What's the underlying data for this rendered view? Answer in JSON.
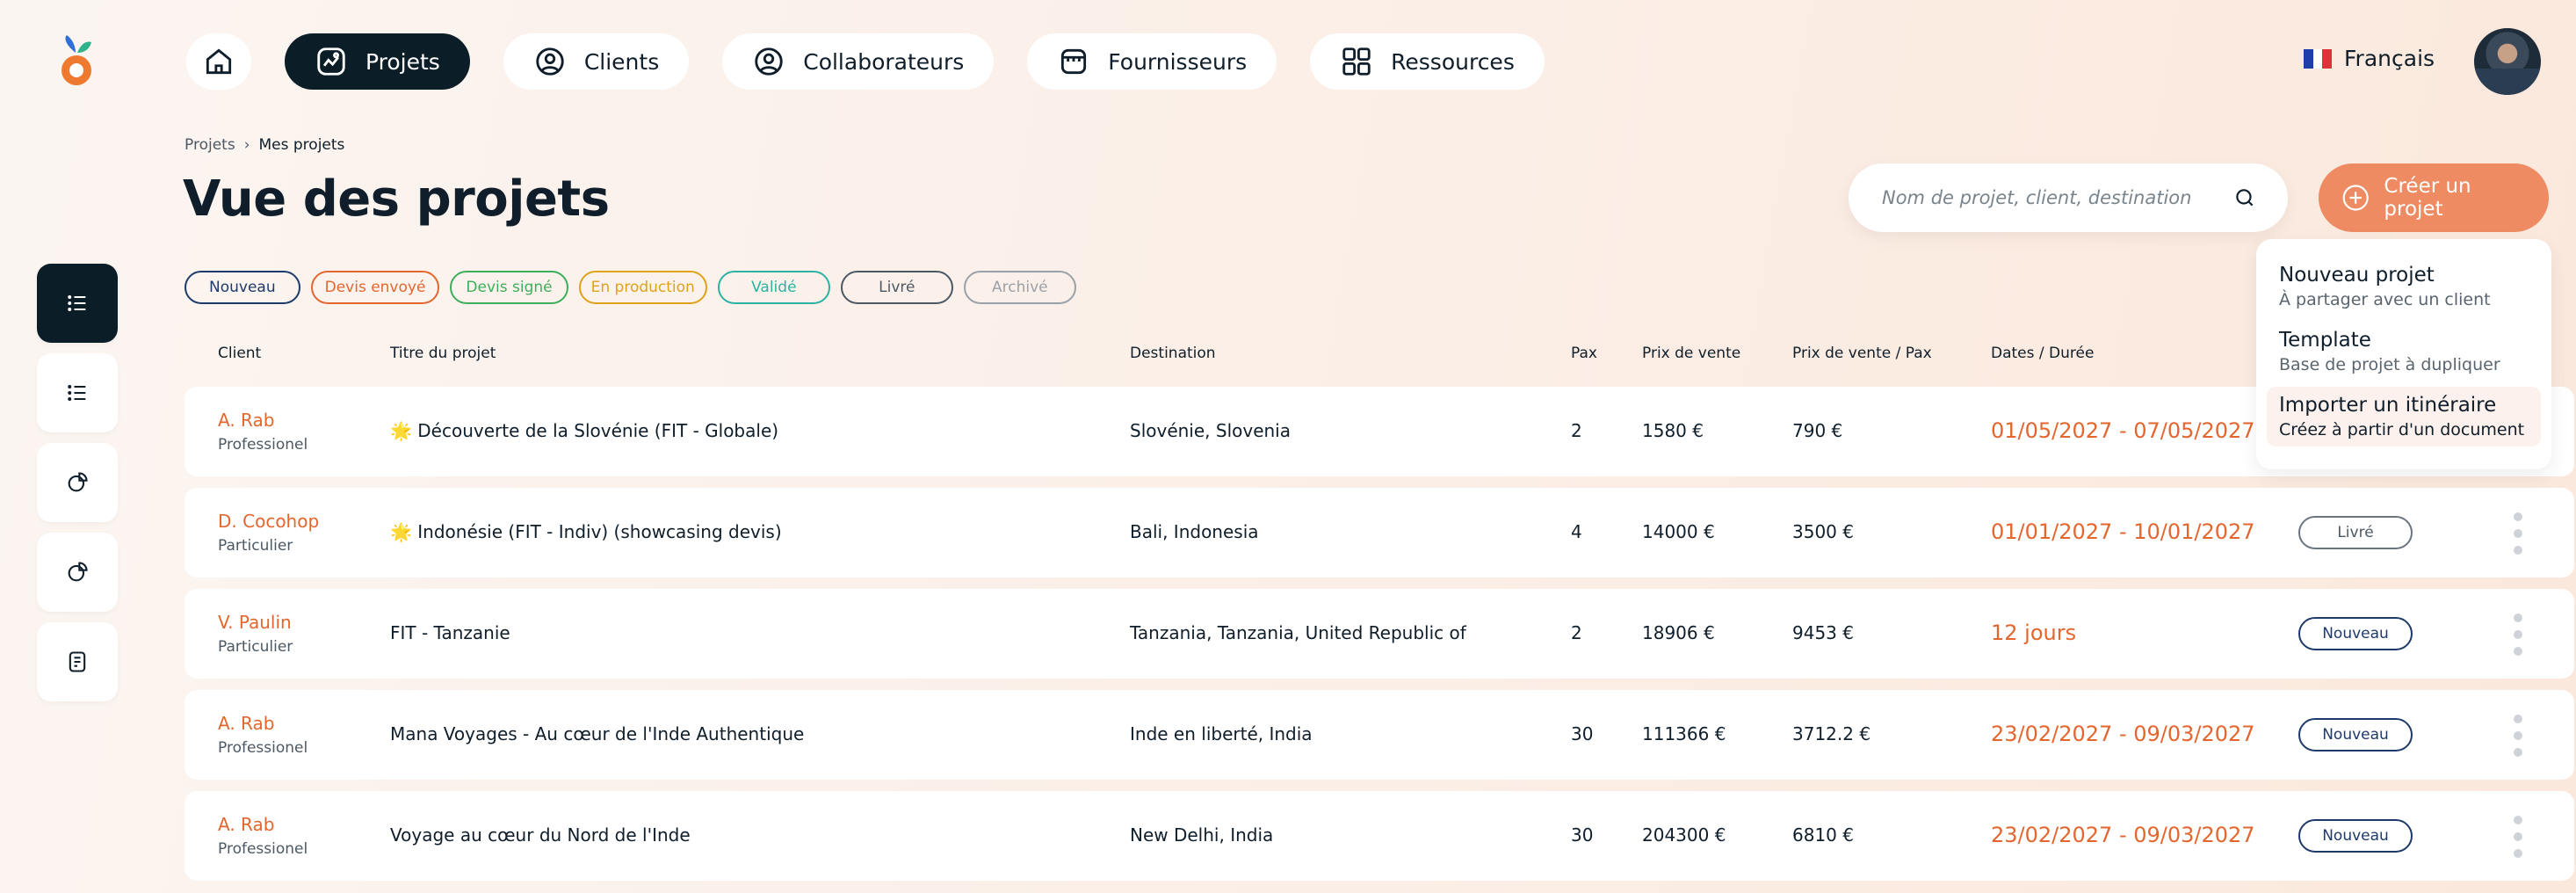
{
  "brand": {
    "colors": {
      "accent": "#ee8b62",
      "dark": "#0b1d26",
      "date": "#e4662f"
    }
  },
  "nav": {
    "home_icon": "home-icon",
    "items": [
      {
        "label": "Projets",
        "icon": "projects-icon",
        "active": true
      },
      {
        "label": "Clients",
        "icon": "user-circle-icon"
      },
      {
        "label": "Collaborateurs",
        "icon": "user-circle-icon"
      },
      {
        "label": "Fournisseurs",
        "icon": "store-icon"
      },
      {
        "label": "Ressources",
        "icon": "grid-icon"
      }
    ]
  },
  "language": {
    "label": "Français",
    "flag": "fr-flag-icon"
  },
  "breadcrumb": {
    "root": "Projets",
    "separator": "›",
    "current": "Mes projets"
  },
  "page": {
    "title": "Vue des projets"
  },
  "search": {
    "placeholder": "Nom de projet, client, destination"
  },
  "create_button": {
    "label": "Créer un projet"
  },
  "filters": [
    {
      "label": "Nouveau",
      "color": "#1e3a6a"
    },
    {
      "label": "Devis envoyé",
      "color": "#e4662f"
    },
    {
      "label": "Devis signé",
      "color": "#3fae5b"
    },
    {
      "label": "En production",
      "color": "#e0a21a"
    },
    {
      "label": "Validé",
      "color": "#2ab3a3"
    },
    {
      "label": "Livré",
      "color": "#4c5964"
    },
    {
      "label": "Archivé",
      "color": "#9aa1a8"
    }
  ],
  "table": {
    "headers": {
      "client": "Client",
      "title": "Titre du projet",
      "destination": "Destination",
      "pax": "Pax",
      "price": "Prix de vente",
      "price_pax": "Prix de vente / Pax",
      "dates": "Dates / Durée"
    },
    "rows": [
      {
        "client": "A. Rab",
        "type": "Professionel",
        "title": "🌟 Découverte de la Slovénie (FIT - Globale)",
        "destination": "Slovénie, Slovenia",
        "pax": "2",
        "price": "1580 €",
        "price_pax": "790 €",
        "dates": "01/05/2027 - 07/05/2027",
        "status": ""
      },
      {
        "client": "D. Cocohop",
        "type": "Particulier",
        "title": "🌟 Indonésie (FIT - Indiv) (showcasing devis)",
        "destination": "Bali, Indonesia",
        "pax": "4",
        "price": "14000 €",
        "price_pax": "3500 €",
        "dates": "01/01/2027 - 10/01/2027",
        "status": "Livré"
      },
      {
        "client": "V. Paulin",
        "type": "Particulier",
        "title": "FIT - Tanzanie",
        "destination": "Tanzania, Tanzania, United Republic of",
        "pax": "2",
        "price": "18906 €",
        "price_pax": "9453 €",
        "dates": "12 jours",
        "status": "Nouveau"
      },
      {
        "client": "A. Rab",
        "type": "Professionel",
        "title": "Mana Voyages - Au cœur de l'Inde Authentique",
        "destination": "Inde en liberté, India",
        "pax": "30",
        "price": "111366 €",
        "price_pax": "3712.2 €",
        "dates": "23/02/2027 - 09/03/2027",
        "status": "Nouveau"
      },
      {
        "client": "A. Rab",
        "type": "Professionel",
        "title": "Voyage au cœur du Nord de l'Inde",
        "destination": "New Delhi, India",
        "pax": "30",
        "price": "204300 €",
        "price_pax": "6810 €",
        "dates": "23/02/2027 - 09/03/2027",
        "status": "Nouveau"
      }
    ]
  },
  "dropdown": {
    "items": [
      {
        "title": "Nouveau projet",
        "subtitle": "À partager avec un client"
      },
      {
        "title": "Template",
        "subtitle": "Base de projet à dupliquer"
      },
      {
        "title": "Importer un itinéraire",
        "subtitle": "Créez à partir d'un document"
      }
    ]
  }
}
